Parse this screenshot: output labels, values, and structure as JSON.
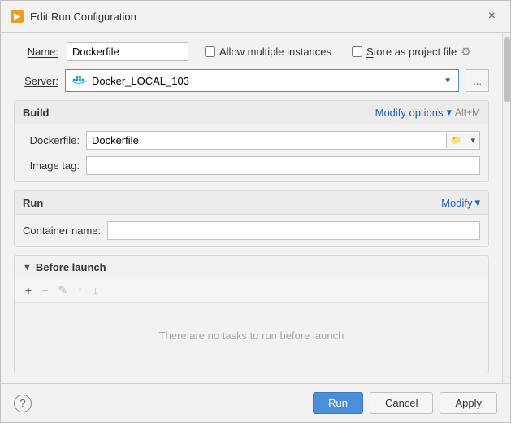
{
  "dialog": {
    "title": "Edit Run Configuration",
    "close_label": "×"
  },
  "title_icon": "▶",
  "name_row": {
    "label": "Name:",
    "value": "Dockerfile",
    "placeholder": ""
  },
  "allow_multiple": {
    "label": "Allow m",
    "label2": "ultiple instances"
  },
  "allow_multiple_full": "Allow multiple instances",
  "store_as_project": "Store as project file",
  "server_row": {
    "label": "Server:",
    "value": "Docker_LOCAL_103",
    "more_label": "..."
  },
  "build_section": {
    "title": "Build",
    "action_label": "Modify options",
    "action_icon": "▾",
    "shortcut": "Alt+M",
    "dockerfile_label": "Dockerfile:",
    "dockerfile_value": "Dockerfile",
    "imagetag_label": "Image tag:"
  },
  "run_section": {
    "title": "Run",
    "action_label": "Modify",
    "action_icon": "▾",
    "container_label": "Container name:"
  },
  "before_launch": {
    "title": "Before launch",
    "empty_text": "There are no tasks to run before launch",
    "add_label": "+",
    "remove_label": "−",
    "edit_label": "✎",
    "up_label": "↑",
    "down_label": "↓"
  },
  "footer": {
    "help_label": "?",
    "run_label": "Run",
    "cancel_label": "Cancel",
    "apply_label": "Apply"
  }
}
